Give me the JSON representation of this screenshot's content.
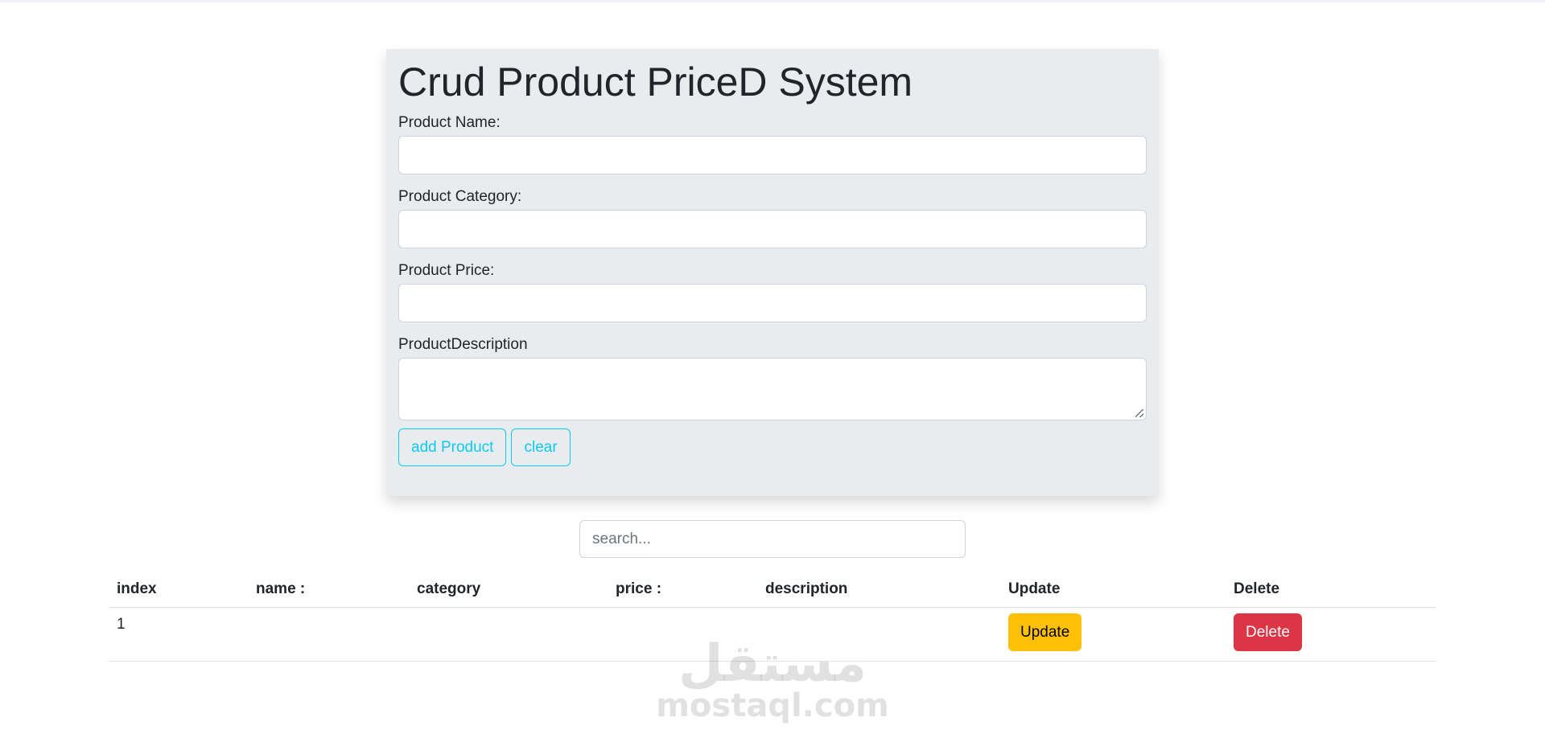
{
  "form": {
    "title": "Crud Product PriceD System",
    "name_label": "Product Name:",
    "name_value": "",
    "category_label": "Product Category:",
    "category_value": "",
    "price_label": "Product Price:",
    "price_value": "",
    "description_label": "ProductDescription",
    "description_value": "",
    "add_button": "add Product",
    "clear_button": "clear"
  },
  "search": {
    "placeholder": "search...",
    "value": ""
  },
  "table": {
    "headers": [
      "index",
      "name :",
      "category",
      "price :",
      "description",
      "Update",
      "Delete"
    ],
    "rows": [
      {
        "index": "1",
        "name": "",
        "category": "",
        "price": "",
        "description": "",
        "update_label": "Update",
        "delete_label": "Delete"
      }
    ]
  },
  "watermark": {
    "arabic": "مستقل",
    "latin": "mostaql.com"
  },
  "colors": {
    "card_bg": "#e9ecef",
    "info": "#0dcaf0",
    "warning": "#ffc107",
    "danger": "#dc3545"
  }
}
